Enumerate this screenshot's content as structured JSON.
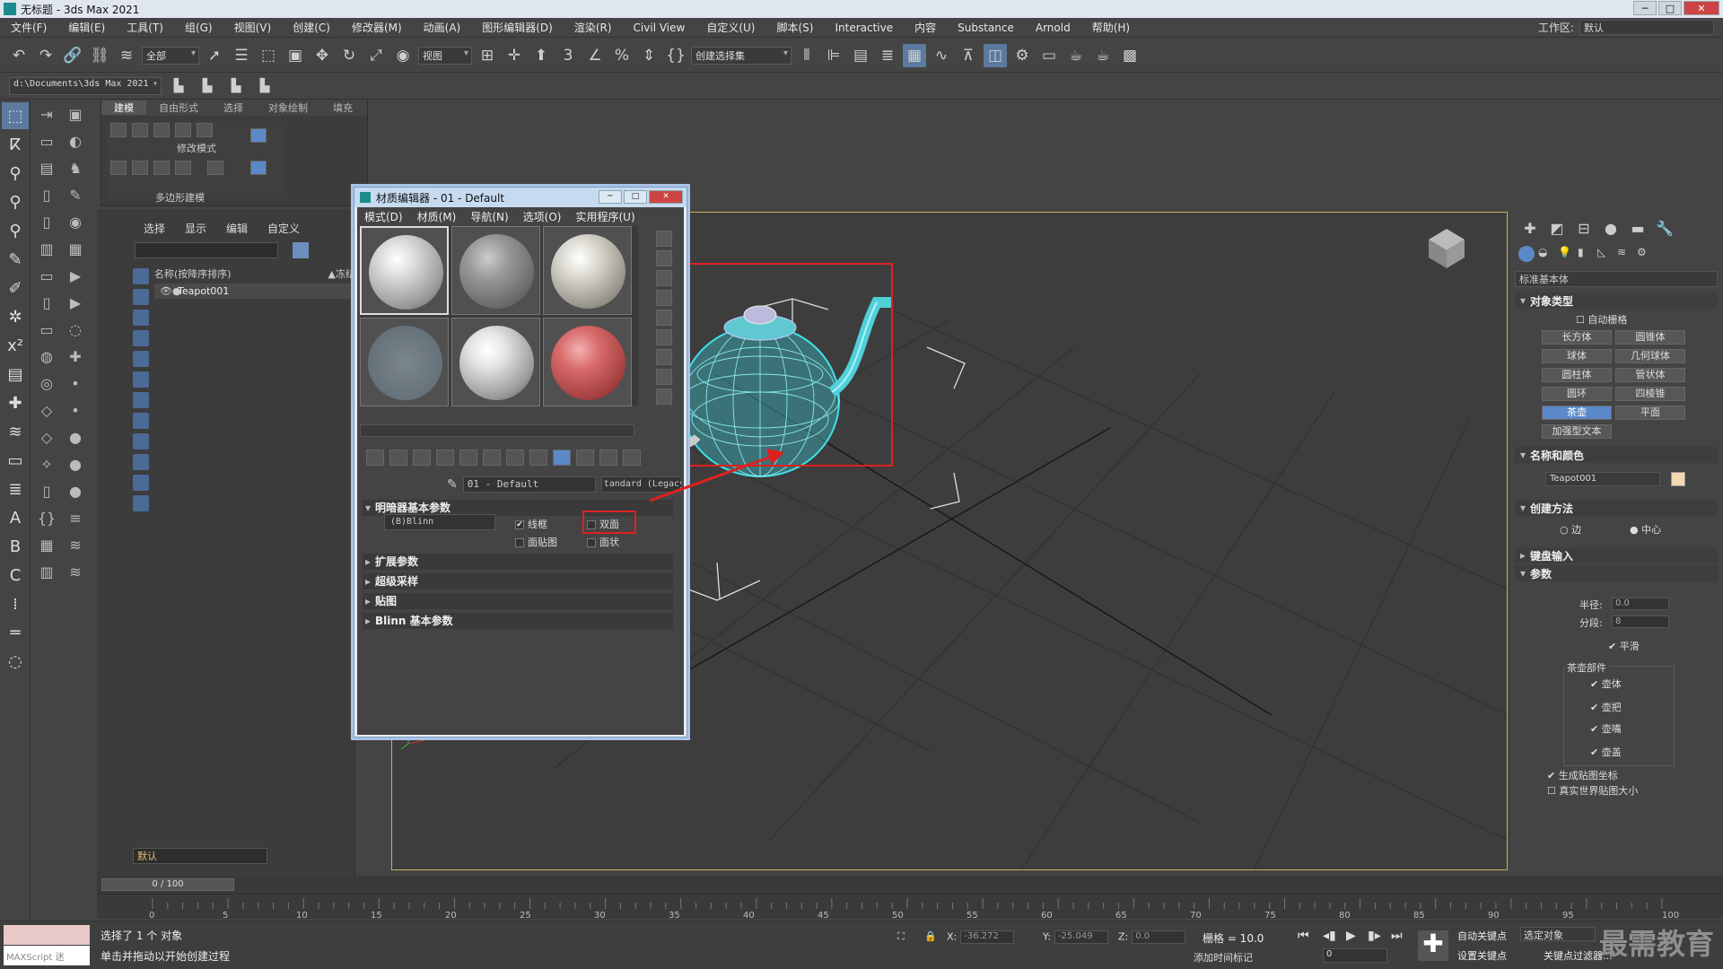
{
  "app": {
    "title": "无标题 - 3ds Max 2021"
  },
  "menu": [
    "文件(F)",
    "编辑(E)",
    "工具(T)",
    "组(G)",
    "视图(V)",
    "创建(C)",
    "修改器(M)",
    "动画(A)",
    "图形编辑器(D)",
    "渲染(R)",
    "Civil View",
    "自定义(U)",
    "脚本(S)",
    "Interactive",
    "内容",
    "Substance",
    "Arnold",
    "帮助(H)"
  ],
  "workspace": {
    "label": "工作区:",
    "value": "默认"
  },
  "toolbar": {
    "filter": "全部",
    "refcoord": "视图",
    "selset": "创建选择集"
  },
  "path": "d:\\Documents\\3ds Max 2021",
  "ribbon": {
    "tabs": [
      "建模",
      "自由形式",
      "选择",
      "对象绘制",
      "填充"
    ],
    "group_label": "修改模式",
    "bottom_label": "多边形建模"
  },
  "explorer": {
    "tabs": [
      "选择",
      "显示",
      "编辑",
      "自定义"
    ],
    "header": "名称(按降序排序)",
    "frozen": "▲冻结",
    "row": "Teapot001",
    "layer": "默认"
  },
  "mated": {
    "title": "材质编辑器 - 01 - Default",
    "menu": [
      "模式(D)",
      "材质(M)",
      "导航(N)",
      "选项(O)",
      "实用程序(U)"
    ],
    "mat_name": "01 - Default",
    "mat_type": "tandard (Legacy",
    "rollouts": [
      "明暗器基本参数",
      "扩展参数",
      "超级采样",
      "贴图",
      "Blinn 基本参数"
    ],
    "shader": "(B)Blinn",
    "chk_wire": "线框",
    "chk_2side": "双面",
    "chk_facemap": "面贴图",
    "chk_faceted": "面状"
  },
  "rpanel": {
    "type": "标准基本体",
    "obj_type": "对象类型",
    "autogrid": "自动栅格",
    "buttons": [
      "长方体",
      "圆锥体",
      "球体",
      "几何球体",
      "圆柱体",
      "管状体",
      "圆环",
      "四棱锥",
      "茶壶",
      "平面"
    ],
    "enhanced_text": "加强型文本",
    "name_color": "名称和颜色",
    "obj_name": "Teapot001",
    "create_method": "创建方法",
    "edge": "边",
    "center": "中心",
    "kbd": "键盘输入",
    "params": "参数",
    "radius_label": "半径:",
    "radius": "0.0",
    "segs_label": "分段:",
    "segs": "8",
    "smooth": "平滑",
    "parts": "茶壶部件",
    "body": "壶体",
    "handle": "壶把",
    "spout": "壶嘴",
    "lid": "壶盖",
    "gen_uv": "生成贴图坐标",
    "real_world": "真实世界贴图大小"
  },
  "timeline": {
    "frame": "0 / 100",
    "ticks": [
      "0",
      "5",
      "10",
      "15",
      "20",
      "25",
      "30",
      "35",
      "40",
      "45",
      "50",
      "55",
      "60",
      "65",
      "70",
      "75",
      "80",
      "85",
      "90",
      "95",
      "100"
    ]
  },
  "status": {
    "maxscript": "MAXScript 迷",
    "msg1": "选择了 1 个 对象",
    "msg2": "单击并拖动以开始创建过程",
    "x": "-36.272",
    "y": "-25.049",
    "z": "0.0",
    "grid": "栅格 = 10.0",
    "addtime": "添加时间标记",
    "autokey": "自动关键点",
    "setkey": "设置关键点",
    "selected": "选定对象",
    "keyfilter": "关键点过滤器...",
    "frame": "0",
    "watermark": "最需教育"
  }
}
